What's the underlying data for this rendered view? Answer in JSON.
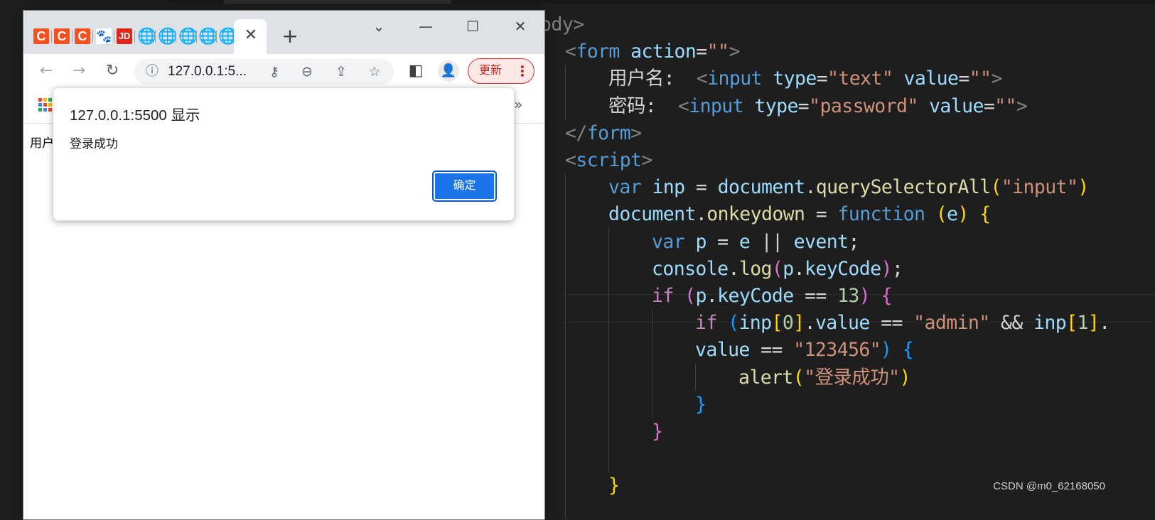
{
  "editor": {
    "lines": [
      [
        [
          "tag",
          "ody>"
        ]
      ],
      [
        [
          "tag",
          "<"
        ],
        [
          "tn",
          "form"
        ],
        [
          "tx",
          " "
        ],
        [
          "at",
          "action"
        ],
        [
          "tx",
          "="
        ],
        [
          "st",
          "\"\""
        ],
        [
          "tag",
          ">"
        ]
      ],
      [
        [
          "tx",
          "用户名:  "
        ],
        [
          "tag",
          "<"
        ],
        [
          "tn",
          "input"
        ],
        [
          "tx",
          " "
        ],
        [
          "at",
          "type"
        ],
        [
          "tx",
          "="
        ],
        [
          "st",
          "\"text\""
        ],
        [
          "tx",
          " "
        ],
        [
          "at",
          "value"
        ],
        [
          "tx",
          "="
        ],
        [
          "st",
          "\"\""
        ],
        [
          "tag",
          ">"
        ]
      ],
      [
        [
          "tx",
          "密码:  "
        ],
        [
          "tag",
          "<"
        ],
        [
          "tn",
          "input"
        ],
        [
          "tx",
          " "
        ],
        [
          "at",
          "type"
        ],
        [
          "tx",
          "="
        ],
        [
          "st",
          "\"password\""
        ],
        [
          "tx",
          " "
        ],
        [
          "at",
          "value"
        ],
        [
          "tx",
          "="
        ],
        [
          "st",
          "\"\""
        ],
        [
          "tag",
          ">"
        ]
      ],
      [
        [
          "tag",
          "</"
        ],
        [
          "tn",
          "form"
        ],
        [
          "tag",
          ">"
        ]
      ],
      [
        [
          "tag",
          "<"
        ],
        [
          "tn",
          "script"
        ],
        [
          "tag",
          ">"
        ]
      ],
      [
        [
          "kw",
          "var"
        ],
        [
          "tx",
          " "
        ],
        [
          "vr",
          "inp"
        ],
        [
          "tx",
          " = "
        ],
        [
          "vr",
          "document"
        ],
        [
          "tx",
          "."
        ],
        [
          "fn",
          "querySelectorAll"
        ],
        [
          "b1",
          "("
        ],
        [
          "st",
          "\"input\""
        ],
        [
          "b1",
          ")"
        ]
      ],
      [
        [
          "vr",
          "document"
        ],
        [
          "tx",
          "."
        ],
        [
          "fn",
          "onkeydown"
        ],
        [
          "tx",
          " = "
        ],
        [
          "kw",
          "function"
        ],
        [
          "tx",
          " "
        ],
        [
          "b1",
          "("
        ],
        [
          "vr",
          "e"
        ],
        [
          "b1",
          ")"
        ],
        [
          "tx",
          " "
        ],
        [
          "b1",
          "{"
        ]
      ],
      [
        [
          "kw",
          "var"
        ],
        [
          "tx",
          " "
        ],
        [
          "vr",
          "p"
        ],
        [
          "tx",
          " = "
        ],
        [
          "vr",
          "e"
        ],
        [
          "tx",
          " || "
        ],
        [
          "vr",
          "event"
        ],
        [
          "tx",
          ";"
        ]
      ],
      [
        [
          "vr",
          "console"
        ],
        [
          "tx",
          "."
        ],
        [
          "fn",
          "log"
        ],
        [
          "b2",
          "("
        ],
        [
          "vr",
          "p"
        ],
        [
          "tx",
          "."
        ],
        [
          "vr",
          "keyCode"
        ],
        [
          "b2",
          ")"
        ],
        [
          "tx",
          ";"
        ]
      ],
      [
        [
          "ctl",
          "if"
        ],
        [
          "tx",
          " "
        ],
        [
          "b2",
          "("
        ],
        [
          "vr",
          "p"
        ],
        [
          "tx",
          "."
        ],
        [
          "vr",
          "keyCode"
        ],
        [
          "tx",
          " == "
        ],
        [
          "nm",
          "13"
        ],
        [
          "b2",
          ")"
        ],
        [
          "tx",
          " "
        ],
        [
          "b2",
          "{"
        ]
      ],
      [
        [
          "ctl",
          "if"
        ],
        [
          "tx",
          " "
        ],
        [
          "b3",
          "("
        ],
        [
          "vr",
          "inp"
        ],
        [
          "b1",
          "["
        ],
        [
          "nm",
          "0"
        ],
        [
          "b1",
          "]"
        ],
        [
          "tx",
          "."
        ],
        [
          "vr",
          "value"
        ],
        [
          "tx",
          " == "
        ],
        [
          "st",
          "\"admin\""
        ],
        [
          "tx",
          " && "
        ],
        [
          "vr",
          "inp"
        ],
        [
          "b1",
          "["
        ],
        [
          "nm",
          "1"
        ],
        [
          "b1",
          "]"
        ],
        [
          "tx",
          "."
        ]
      ],
      [
        [
          "vr",
          "value"
        ],
        [
          "tx",
          " == "
        ],
        [
          "st",
          "\"123456\""
        ],
        [
          "b3",
          ")"
        ],
        [
          "tx",
          " "
        ],
        [
          "b3",
          "{"
        ]
      ],
      [
        [
          "fn",
          "alert"
        ],
        [
          "b1",
          "("
        ],
        [
          "st",
          "\"登录成功\""
        ],
        [
          "b1",
          ")"
        ]
      ],
      [
        [
          "b3",
          "}"
        ]
      ],
      [
        [
          "b2",
          "}"
        ]
      ],
      [],
      [
        [
          "b1",
          "}"
        ]
      ]
    ],
    "watermark": "CSDN @m0_62168050"
  },
  "browser": {
    "tabs": [
      {
        "icon": "csdn-c-icon",
        "glyph": "C"
      },
      {
        "icon": "csdn-c-icon",
        "glyph": "C"
      },
      {
        "icon": "csdn-c-icon",
        "glyph": "C"
      },
      {
        "icon": "baidu-paw-icon",
        "glyph": "🐾"
      },
      {
        "icon": "jd-icon",
        "glyph": "JD"
      },
      {
        "icon": "globe-icon",
        "glyph": "🌐"
      },
      {
        "icon": "globe-icon",
        "glyph": "🌐"
      },
      {
        "icon": "globe-icon",
        "glyph": "🌐"
      },
      {
        "icon": "globe-icon",
        "glyph": "🌐"
      },
      {
        "icon": "globe-icon",
        "glyph": "🌐"
      }
    ],
    "active_tab_close": "✕",
    "new_tab": "+",
    "window_controls": {
      "tab_search": "⌄",
      "minimize": "—",
      "maximize": "☐",
      "close": "✕"
    },
    "nav": {
      "back": "←",
      "forward": "→",
      "reload": "↻"
    },
    "omnibox": {
      "info_icon": "ⓘ",
      "url": "127.0.0.1:5...",
      "key_icon": "⚷",
      "zoom_icon": "⊖",
      "share_icon": "⇪",
      "star_icon": "☆"
    },
    "side_panel_icon": "◧",
    "profile_icon": "👤",
    "update_label": "更新",
    "update_menu": "⋮",
    "bookmarks_more": "»",
    "page_text": "用户",
    "accent": "#1a73e8"
  },
  "alert": {
    "title": "127.0.0.1:5500 显示",
    "message": "登录成功",
    "ok_label": "确定"
  }
}
